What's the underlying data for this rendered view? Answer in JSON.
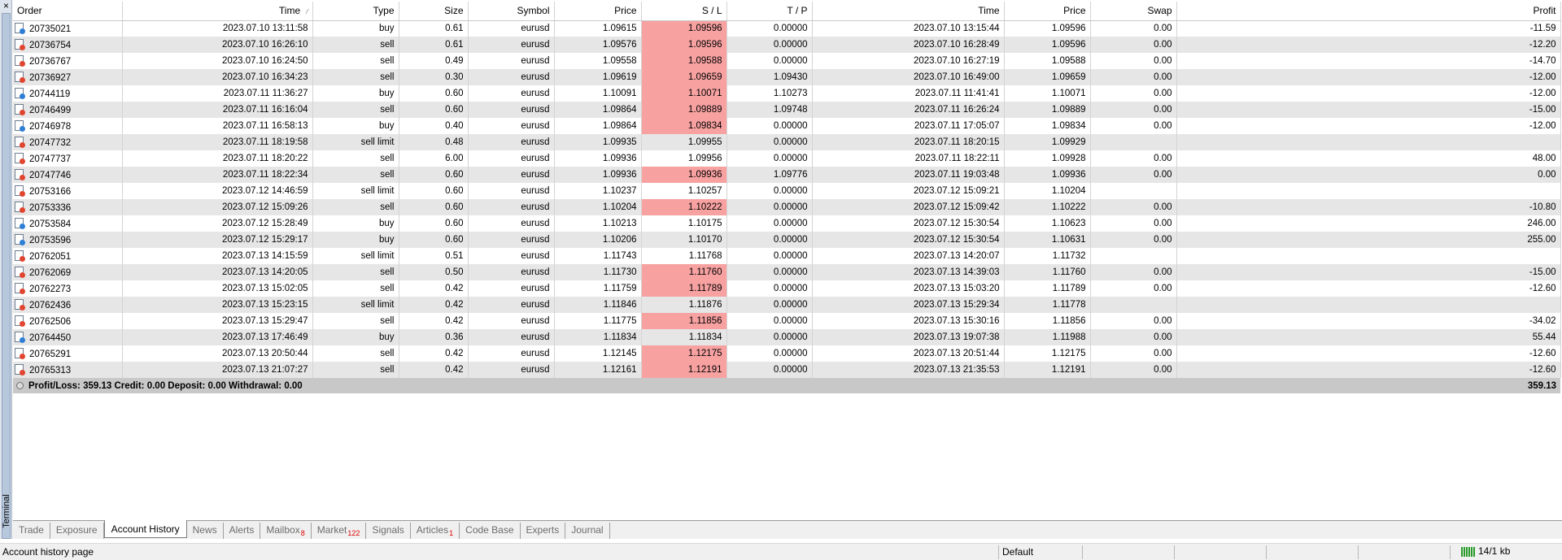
{
  "window": {
    "close_glyph": "×",
    "side_label": "Terminal"
  },
  "table": {
    "columns": [
      "Order",
      "Time",
      "Type",
      "Size",
      "Symbol",
      "Price",
      "S / L",
      "T / P",
      "Time",
      "Price",
      "Swap",
      "Profit"
    ],
    "sort_indicator": "⁄",
    "rows": [
      {
        "order": "20735021",
        "open_time": "2023.07.10 13:11:58",
        "type": "buy",
        "size": "0.61",
        "symbol": "eurusd",
        "open_price": "1.09615",
        "sl": "1.09596",
        "sl_hit": true,
        "tp": "0.00000",
        "close_time": "2023.07.10 13:15:44",
        "close_price": "1.09596",
        "swap": "0.00",
        "profit": "-11.59"
      },
      {
        "order": "20736754",
        "open_time": "2023.07.10 16:26:10",
        "type": "sell",
        "size": "0.61",
        "symbol": "eurusd",
        "open_price": "1.09576",
        "sl": "1.09596",
        "sl_hit": true,
        "tp": "0.00000",
        "close_time": "2023.07.10 16:28:49",
        "close_price": "1.09596",
        "swap": "0.00",
        "profit": "-12.20"
      },
      {
        "order": "20736767",
        "open_time": "2023.07.10 16:24:50",
        "type": "sell",
        "size": "0.49",
        "symbol": "eurusd",
        "open_price": "1.09558",
        "sl": "1.09588",
        "sl_hit": true,
        "tp": "0.00000",
        "close_time": "2023.07.10 16:27:19",
        "close_price": "1.09588",
        "swap": "0.00",
        "profit": "-14.70"
      },
      {
        "order": "20736927",
        "open_time": "2023.07.10 16:34:23",
        "type": "sell",
        "size": "0.30",
        "symbol": "eurusd",
        "open_price": "1.09619",
        "sl": "1.09659",
        "sl_hit": true,
        "tp": "1.09430",
        "close_time": "2023.07.10 16:49:00",
        "close_price": "1.09659",
        "swap": "0.00",
        "profit": "-12.00"
      },
      {
        "order": "20744119",
        "open_time": "2023.07.11 11:36:27",
        "type": "buy",
        "size": "0.60",
        "symbol": "eurusd",
        "open_price": "1.10091",
        "sl": "1.10071",
        "sl_hit": true,
        "tp": "1.10273",
        "close_time": "2023.07.11 11:41:41",
        "close_price": "1.10071",
        "swap": "0.00",
        "profit": "-12.00"
      },
      {
        "order": "20746499",
        "open_time": "2023.07.11 16:16:04",
        "type": "sell",
        "size": "0.60",
        "symbol": "eurusd",
        "open_price": "1.09864",
        "sl": "1.09889",
        "sl_hit": true,
        "tp": "1.09748",
        "close_time": "2023.07.11 16:26:24",
        "close_price": "1.09889",
        "swap": "0.00",
        "profit": "-15.00"
      },
      {
        "order": "20746978",
        "open_time": "2023.07.11 16:58:13",
        "type": "buy",
        "size": "0.40",
        "symbol": "eurusd",
        "open_price": "1.09864",
        "sl": "1.09834",
        "sl_hit": true,
        "tp": "0.00000",
        "close_time": "2023.07.11 17:05:07",
        "close_price": "1.09834",
        "swap": "0.00",
        "profit": "-12.00"
      },
      {
        "order": "20747732",
        "open_time": "2023.07.11 18:19:58",
        "type": "sell limit",
        "size": "0.48",
        "symbol": "eurusd",
        "open_price": "1.09935",
        "sl": "1.09955",
        "sl_hit": false,
        "tp": "0.00000",
        "close_time": "2023.07.11 18:20:15",
        "close_price": "1.09929",
        "swap": "",
        "profit": ""
      },
      {
        "order": "20747737",
        "open_time": "2023.07.11 18:20:22",
        "type": "sell",
        "size": "6.00",
        "symbol": "eurusd",
        "open_price": "1.09936",
        "sl": "1.09956",
        "sl_hit": false,
        "tp": "0.00000",
        "close_time": "2023.07.11 18:22:11",
        "close_price": "1.09928",
        "swap": "0.00",
        "profit": "48.00"
      },
      {
        "order": "20747746",
        "open_time": "2023.07.11 18:22:34",
        "type": "sell",
        "size": "0.60",
        "symbol": "eurusd",
        "open_price": "1.09936",
        "sl": "1.09936",
        "sl_hit": true,
        "tp": "1.09776",
        "close_time": "2023.07.11 19:03:48",
        "close_price": "1.09936",
        "swap": "0.00",
        "profit": "0.00"
      },
      {
        "order": "20753166",
        "open_time": "2023.07.12 14:46:59",
        "type": "sell limit",
        "size": "0.60",
        "symbol": "eurusd",
        "open_price": "1.10237",
        "sl": "1.10257",
        "sl_hit": false,
        "tp": "0.00000",
        "close_time": "2023.07.12 15:09:21",
        "close_price": "1.10204",
        "swap": "",
        "profit": ""
      },
      {
        "order": "20753336",
        "open_time": "2023.07.12 15:09:26",
        "type": "sell",
        "size": "0.60",
        "symbol": "eurusd",
        "open_price": "1.10204",
        "sl": "1.10222",
        "sl_hit": true,
        "tp": "0.00000",
        "close_time": "2023.07.12 15:09:42",
        "close_price": "1.10222",
        "swap": "0.00",
        "profit": "-10.80"
      },
      {
        "order": "20753584",
        "open_time": "2023.07.12 15:28:49",
        "type": "buy",
        "size": "0.60",
        "symbol": "eurusd",
        "open_price": "1.10213",
        "sl": "1.10175",
        "sl_hit": false,
        "tp": "0.00000",
        "close_time": "2023.07.12 15:30:54",
        "close_price": "1.10623",
        "swap": "0.00",
        "profit": "246.00"
      },
      {
        "order": "20753596",
        "open_time": "2023.07.12 15:29:17",
        "type": "buy",
        "size": "0.60",
        "symbol": "eurusd",
        "open_price": "1.10206",
        "sl": "1.10170",
        "sl_hit": false,
        "tp": "0.00000",
        "close_time": "2023.07.12 15:30:54",
        "close_price": "1.10631",
        "swap": "0.00",
        "profit": "255.00"
      },
      {
        "order": "20762051",
        "open_time": "2023.07.13 14:15:59",
        "type": "sell limit",
        "size": "0.51",
        "symbol": "eurusd",
        "open_price": "1.11743",
        "sl": "1.11768",
        "sl_hit": false,
        "tp": "0.00000",
        "close_time": "2023.07.13 14:20:07",
        "close_price": "1.11732",
        "swap": "",
        "profit": ""
      },
      {
        "order": "20762069",
        "open_time": "2023.07.13 14:20:05",
        "type": "sell",
        "size": "0.50",
        "symbol": "eurusd",
        "open_price": "1.11730",
        "sl": "1.11760",
        "sl_hit": true,
        "tp": "0.00000",
        "close_time": "2023.07.13 14:39:03",
        "close_price": "1.11760",
        "swap": "0.00",
        "profit": "-15.00"
      },
      {
        "order": "20762273",
        "open_time": "2023.07.13 15:02:05",
        "type": "sell",
        "size": "0.42",
        "symbol": "eurusd",
        "open_price": "1.11759",
        "sl": "1.11789",
        "sl_hit": true,
        "tp": "0.00000",
        "close_time": "2023.07.13 15:03:20",
        "close_price": "1.11789",
        "swap": "0.00",
        "profit": "-12.60"
      },
      {
        "order": "20762436",
        "open_time": "2023.07.13 15:23:15",
        "type": "sell limit",
        "size": "0.42",
        "symbol": "eurusd",
        "open_price": "1.11846",
        "sl": "1.11876",
        "sl_hit": false,
        "tp": "0.00000",
        "close_time": "2023.07.13 15:29:34",
        "close_price": "1.11778",
        "swap": "",
        "profit": ""
      },
      {
        "order": "20762506",
        "open_time": "2023.07.13 15:29:47",
        "type": "sell",
        "size": "0.42",
        "symbol": "eurusd",
        "open_price": "1.11775",
        "sl": "1.11856",
        "sl_hit": true,
        "tp": "0.00000",
        "close_time": "2023.07.13 15:30:16",
        "close_price": "1.11856",
        "swap": "0.00",
        "profit": "-34.02"
      },
      {
        "order": "20764450",
        "open_time": "2023.07.13 17:46:49",
        "type": "buy",
        "size": "0.36",
        "symbol": "eurusd",
        "open_price": "1.11834",
        "sl": "1.11834",
        "sl_hit": false,
        "tp": "0.00000",
        "close_time": "2023.07.13 19:07:38",
        "close_price": "1.11988",
        "swap": "0.00",
        "profit": "55.44"
      },
      {
        "order": "20765291",
        "open_time": "2023.07.13 20:50:44",
        "type": "sell",
        "size": "0.42",
        "symbol": "eurusd",
        "open_price": "1.12145",
        "sl": "1.12175",
        "sl_hit": true,
        "tp": "0.00000",
        "close_time": "2023.07.13 20:51:44",
        "close_price": "1.12175",
        "swap": "0.00",
        "profit": "-12.60"
      },
      {
        "order": "20765313",
        "open_time": "2023.07.13 21:07:27",
        "type": "sell",
        "size": "0.42",
        "symbol": "eurusd",
        "open_price": "1.12161",
        "sl": "1.12191",
        "sl_hit": true,
        "tp": "0.00000",
        "close_time": "2023.07.13 21:35:53",
        "close_price": "1.12191",
        "swap": "0.00",
        "profit": "-12.60"
      }
    ],
    "summary": {
      "text": "Profit/Loss: 359.13  Credit: 0.00  Deposit: 0.00  Withdrawal: 0.00",
      "total": "359.13"
    }
  },
  "tabs": [
    {
      "label": "Trade",
      "badge": ""
    },
    {
      "label": "Exposure",
      "badge": ""
    },
    {
      "label": "Account History",
      "badge": "",
      "active": true
    },
    {
      "label": "News",
      "badge": ""
    },
    {
      "label": "Alerts",
      "badge": ""
    },
    {
      "label": "Mailbox",
      "badge": "8"
    },
    {
      "label": "Market",
      "badge": "122"
    },
    {
      "label": "Signals",
      "badge": ""
    },
    {
      "label": "Articles",
      "badge": "1"
    },
    {
      "label": "Code Base",
      "badge": ""
    },
    {
      "label": "Experts",
      "badge": ""
    },
    {
      "label": "Journal",
      "badge": ""
    }
  ],
  "status": {
    "left_text": "Account history page",
    "profile": "Default",
    "traffic": "14/1 kb"
  },
  "colors": {
    "sl_highlight": "#f7a1a1",
    "buy_icon": "#2f7fd6",
    "sell_icon": "#e2452f",
    "badge_red": "#e00000"
  },
  "icons": {
    "order_icon": "document-order-icon",
    "summary_icon": "circle-icon",
    "traffic_icon": "signal-bars-icon"
  }
}
